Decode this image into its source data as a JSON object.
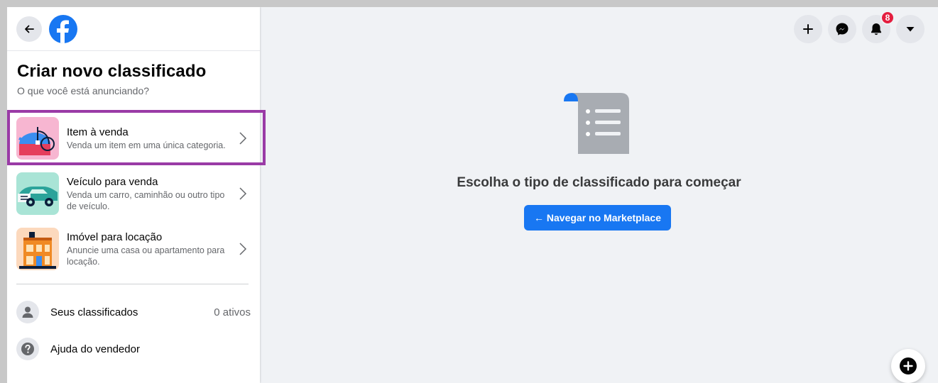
{
  "sidebar": {
    "title": "Criar novo classificado",
    "subtitle": "O que você está anunciando?",
    "options": [
      {
        "label": "Item à venda",
        "description": "Venda um item em uma única categoria.",
        "icon": "kettle-icon",
        "accent": "#f7b6d1"
      },
      {
        "label": "Veículo para venda",
        "description": "Venda um carro, caminhão ou outro tipo de veículo.",
        "icon": "car-icon",
        "accent": "#a9e4d6"
      },
      {
        "label": "Imóvel para locação",
        "description": "Anuncie uma casa ou apartamento para locação.",
        "icon": "house-icon",
        "accent": "#fcd9bd"
      }
    ],
    "footer": {
      "my_listings": "Seus classificados",
      "my_listings_count": "0 ativos",
      "seller_help": "Ajuda do vendedor"
    }
  },
  "main": {
    "message": "Escolha o tipo de classificado para começar",
    "browse_button": "← Navegar no Marketplace"
  },
  "header": {
    "notification_count": "8"
  },
  "colors": {
    "brand": "#1877f2",
    "highlight": "#9a3ba6",
    "badge": "#e41e3f"
  }
}
